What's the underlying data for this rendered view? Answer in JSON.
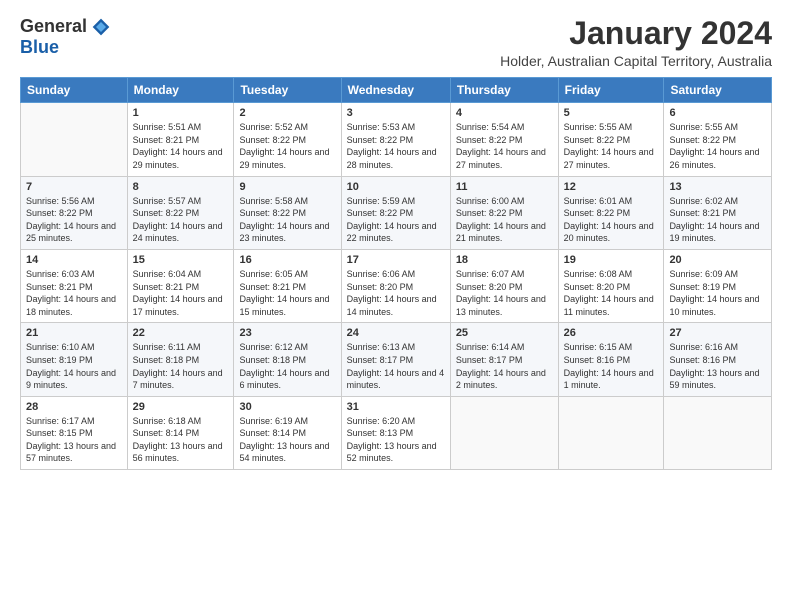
{
  "logo": {
    "general": "General",
    "blue": "Blue"
  },
  "title": "January 2024",
  "location": "Holder, Australian Capital Territory, Australia",
  "days_header": [
    "Sunday",
    "Monday",
    "Tuesday",
    "Wednesday",
    "Thursday",
    "Friday",
    "Saturday"
  ],
  "weeks": [
    [
      {
        "day": "",
        "sunrise": "",
        "sunset": "",
        "daylight": ""
      },
      {
        "day": "1",
        "sunrise": "Sunrise: 5:51 AM",
        "sunset": "Sunset: 8:21 PM",
        "daylight": "Daylight: 14 hours and 29 minutes."
      },
      {
        "day": "2",
        "sunrise": "Sunrise: 5:52 AM",
        "sunset": "Sunset: 8:22 PM",
        "daylight": "Daylight: 14 hours and 29 minutes."
      },
      {
        "day": "3",
        "sunrise": "Sunrise: 5:53 AM",
        "sunset": "Sunset: 8:22 PM",
        "daylight": "Daylight: 14 hours and 28 minutes."
      },
      {
        "day": "4",
        "sunrise": "Sunrise: 5:54 AM",
        "sunset": "Sunset: 8:22 PM",
        "daylight": "Daylight: 14 hours and 27 minutes."
      },
      {
        "day": "5",
        "sunrise": "Sunrise: 5:55 AM",
        "sunset": "Sunset: 8:22 PM",
        "daylight": "Daylight: 14 hours and 27 minutes."
      },
      {
        "day": "6",
        "sunrise": "Sunrise: 5:55 AM",
        "sunset": "Sunset: 8:22 PM",
        "daylight": "Daylight: 14 hours and 26 minutes."
      }
    ],
    [
      {
        "day": "7",
        "sunrise": "Sunrise: 5:56 AM",
        "sunset": "Sunset: 8:22 PM",
        "daylight": "Daylight: 14 hours and 25 minutes."
      },
      {
        "day": "8",
        "sunrise": "Sunrise: 5:57 AM",
        "sunset": "Sunset: 8:22 PM",
        "daylight": "Daylight: 14 hours and 24 minutes."
      },
      {
        "day": "9",
        "sunrise": "Sunrise: 5:58 AM",
        "sunset": "Sunset: 8:22 PM",
        "daylight": "Daylight: 14 hours and 23 minutes."
      },
      {
        "day": "10",
        "sunrise": "Sunrise: 5:59 AM",
        "sunset": "Sunset: 8:22 PM",
        "daylight": "Daylight: 14 hours and 22 minutes."
      },
      {
        "day": "11",
        "sunrise": "Sunrise: 6:00 AM",
        "sunset": "Sunset: 8:22 PM",
        "daylight": "Daylight: 14 hours and 21 minutes."
      },
      {
        "day": "12",
        "sunrise": "Sunrise: 6:01 AM",
        "sunset": "Sunset: 8:22 PM",
        "daylight": "Daylight: 14 hours and 20 minutes."
      },
      {
        "day": "13",
        "sunrise": "Sunrise: 6:02 AM",
        "sunset": "Sunset: 8:21 PM",
        "daylight": "Daylight: 14 hours and 19 minutes."
      }
    ],
    [
      {
        "day": "14",
        "sunrise": "Sunrise: 6:03 AM",
        "sunset": "Sunset: 8:21 PM",
        "daylight": "Daylight: 14 hours and 18 minutes."
      },
      {
        "day": "15",
        "sunrise": "Sunrise: 6:04 AM",
        "sunset": "Sunset: 8:21 PM",
        "daylight": "Daylight: 14 hours and 17 minutes."
      },
      {
        "day": "16",
        "sunrise": "Sunrise: 6:05 AM",
        "sunset": "Sunset: 8:21 PM",
        "daylight": "Daylight: 14 hours and 15 minutes."
      },
      {
        "day": "17",
        "sunrise": "Sunrise: 6:06 AM",
        "sunset": "Sunset: 8:20 PM",
        "daylight": "Daylight: 14 hours and 14 minutes."
      },
      {
        "day": "18",
        "sunrise": "Sunrise: 6:07 AM",
        "sunset": "Sunset: 8:20 PM",
        "daylight": "Daylight: 14 hours and 13 minutes."
      },
      {
        "day": "19",
        "sunrise": "Sunrise: 6:08 AM",
        "sunset": "Sunset: 8:20 PM",
        "daylight": "Daylight: 14 hours and 11 minutes."
      },
      {
        "day": "20",
        "sunrise": "Sunrise: 6:09 AM",
        "sunset": "Sunset: 8:19 PM",
        "daylight": "Daylight: 14 hours and 10 minutes."
      }
    ],
    [
      {
        "day": "21",
        "sunrise": "Sunrise: 6:10 AM",
        "sunset": "Sunset: 8:19 PM",
        "daylight": "Daylight: 14 hours and 9 minutes."
      },
      {
        "day": "22",
        "sunrise": "Sunrise: 6:11 AM",
        "sunset": "Sunset: 8:18 PM",
        "daylight": "Daylight: 14 hours and 7 minutes."
      },
      {
        "day": "23",
        "sunrise": "Sunrise: 6:12 AM",
        "sunset": "Sunset: 8:18 PM",
        "daylight": "Daylight: 14 hours and 6 minutes."
      },
      {
        "day": "24",
        "sunrise": "Sunrise: 6:13 AM",
        "sunset": "Sunset: 8:17 PM",
        "daylight": "Daylight: 14 hours and 4 minutes."
      },
      {
        "day": "25",
        "sunrise": "Sunrise: 6:14 AM",
        "sunset": "Sunset: 8:17 PM",
        "daylight": "Daylight: 14 hours and 2 minutes."
      },
      {
        "day": "26",
        "sunrise": "Sunrise: 6:15 AM",
        "sunset": "Sunset: 8:16 PM",
        "daylight": "Daylight: 14 hours and 1 minute."
      },
      {
        "day": "27",
        "sunrise": "Sunrise: 6:16 AM",
        "sunset": "Sunset: 8:16 PM",
        "daylight": "Daylight: 13 hours and 59 minutes."
      }
    ],
    [
      {
        "day": "28",
        "sunrise": "Sunrise: 6:17 AM",
        "sunset": "Sunset: 8:15 PM",
        "daylight": "Daylight: 13 hours and 57 minutes."
      },
      {
        "day": "29",
        "sunrise": "Sunrise: 6:18 AM",
        "sunset": "Sunset: 8:14 PM",
        "daylight": "Daylight: 13 hours and 56 minutes."
      },
      {
        "day": "30",
        "sunrise": "Sunrise: 6:19 AM",
        "sunset": "Sunset: 8:14 PM",
        "daylight": "Daylight: 13 hours and 54 minutes."
      },
      {
        "day": "31",
        "sunrise": "Sunrise: 6:20 AM",
        "sunset": "Sunset: 8:13 PM",
        "daylight": "Daylight: 13 hours and 52 minutes."
      },
      {
        "day": "",
        "sunrise": "",
        "sunset": "",
        "daylight": ""
      },
      {
        "day": "",
        "sunrise": "",
        "sunset": "",
        "daylight": ""
      },
      {
        "day": "",
        "sunrise": "",
        "sunset": "",
        "daylight": ""
      }
    ]
  ]
}
